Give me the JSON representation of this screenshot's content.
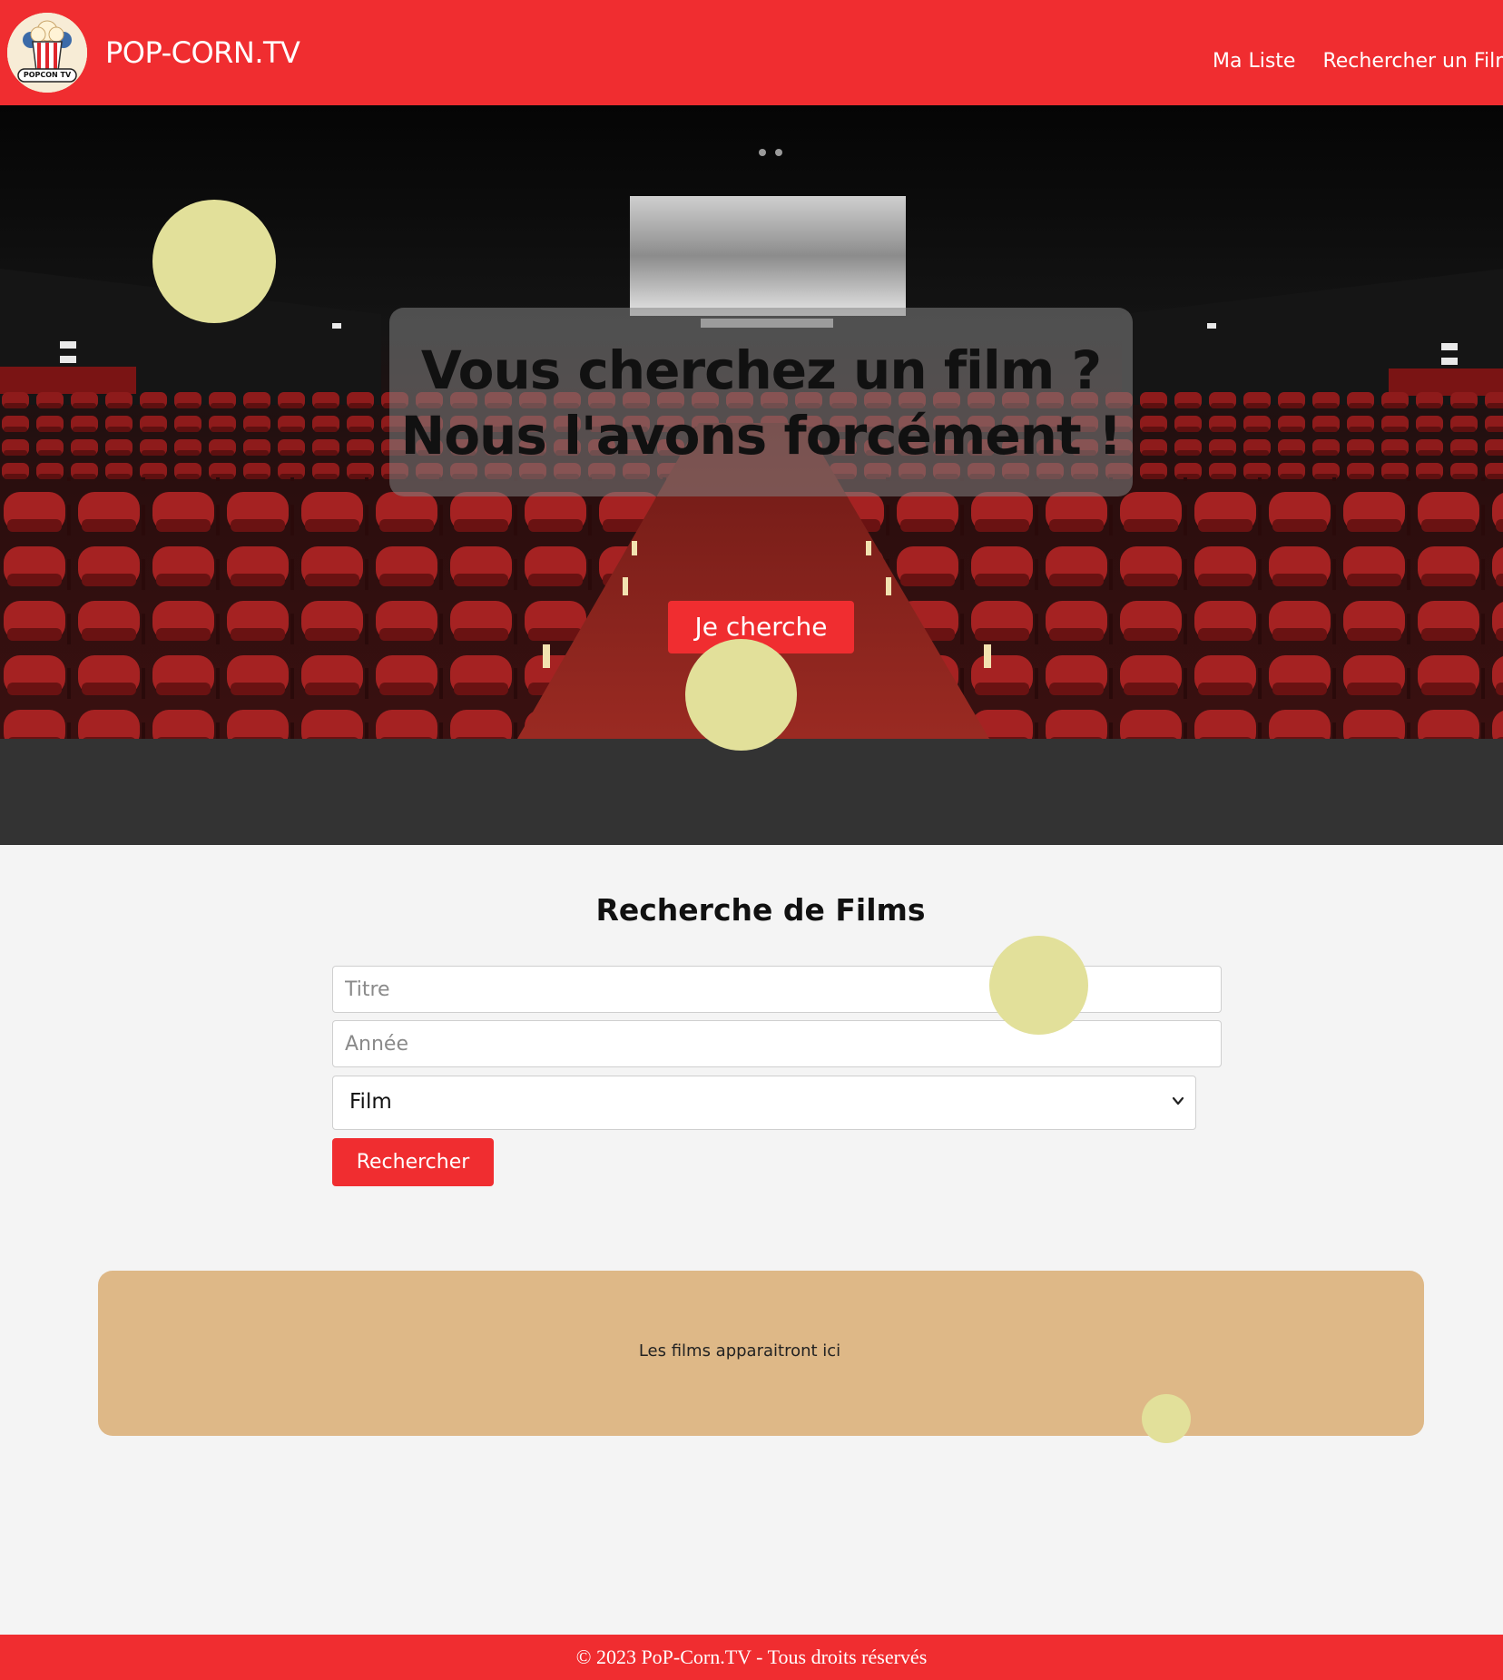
{
  "header": {
    "brand": "POP-CORN.TV",
    "logo_text": "POPCON TV",
    "nav": [
      {
        "label": "Ma Liste"
      },
      {
        "label": "Rechercher un Film"
      }
    ]
  },
  "hero": {
    "headline_line1": "Vous cherchez un film ?",
    "headline_line2": "Nous l'avons forcément !",
    "cta_label": "Je cherche"
  },
  "search": {
    "title": "Recherche de Films",
    "title_placeholder": "Titre",
    "year_placeholder": "Année",
    "type_selected": "Film",
    "submit_label": "Rechercher"
  },
  "results": {
    "empty_message": "Les films apparaitront ici"
  },
  "footer": {
    "copyright": "© 2023 PoP-Corn.TV - Tous droits réservés"
  },
  "colors": {
    "primary": "#f02d30",
    "dark_band": "#333333",
    "results_bg": "#deb887",
    "bubble": "#e2e09a",
    "page_bg": "#f4f4f4"
  }
}
